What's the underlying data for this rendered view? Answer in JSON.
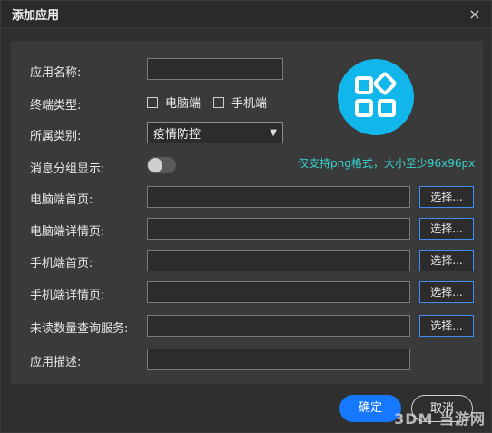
{
  "dialog": {
    "title": "添加应用",
    "close_symbol": "×"
  },
  "form": {
    "app_name": {
      "label": "应用名称:",
      "value": ""
    },
    "terminal_type": {
      "label": "终端类型:",
      "options": [
        {
          "label": "电脑端",
          "checked": false
        },
        {
          "label": "手机端",
          "checked": false
        }
      ]
    },
    "category": {
      "label": "所属类别:",
      "selected": "疫情防控"
    },
    "group_display": {
      "label": "消息分组显示:",
      "enabled": false
    },
    "pc_home": {
      "label": "电脑端首页:",
      "value": "",
      "choose_label": "选择..."
    },
    "pc_detail": {
      "label": "电脑端详情页:",
      "value": "",
      "choose_label": "选择..."
    },
    "mobile_home": {
      "label": "手机端首页:",
      "value": "",
      "choose_label": "选择..."
    },
    "mobile_detail": {
      "label": "手机端详情页:",
      "value": "",
      "choose_label": "选择..."
    },
    "unread_service": {
      "label": "未读数量查询服务:",
      "value": "",
      "choose_label": "选择..."
    },
    "description": {
      "label": "应用描述:",
      "value": ""
    }
  },
  "icon_area": {
    "icon_name": "apps-grid-icon",
    "accent_color": "#11b7ea",
    "hint": "仅支持png格式，大小至少96x96px"
  },
  "footer": {
    "ok_label": "确定",
    "cancel_label": "取消"
  },
  "watermark": "3DM 当游网"
}
